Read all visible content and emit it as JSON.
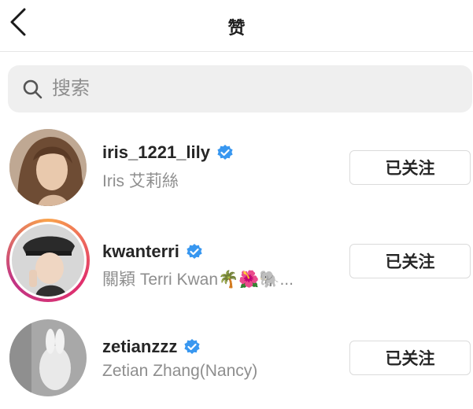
{
  "header": {
    "title": "赞",
    "back_icon": "chevron-left-icon"
  },
  "search": {
    "placeholder": "搜索",
    "icon": "search-icon"
  },
  "colors": {
    "verified": "#3897f0",
    "muted_text": "#8e8e8e",
    "story_ring": "#e1306c"
  },
  "users": [
    {
      "username": "iris_1221_lily",
      "full_name": "Iris 艾莉絲",
      "verified": true,
      "button": "已关注"
    },
    {
      "username": "kwanterri",
      "full_name": "關穎 Terri Kwan🌴🌺🐘...",
      "verified": true,
      "button": "已关注",
      "has_story": true
    },
    {
      "username": "zetianzzz",
      "full_name": "Zetian Zhang(Nancy)",
      "verified": true,
      "button": "已关注"
    }
  ]
}
